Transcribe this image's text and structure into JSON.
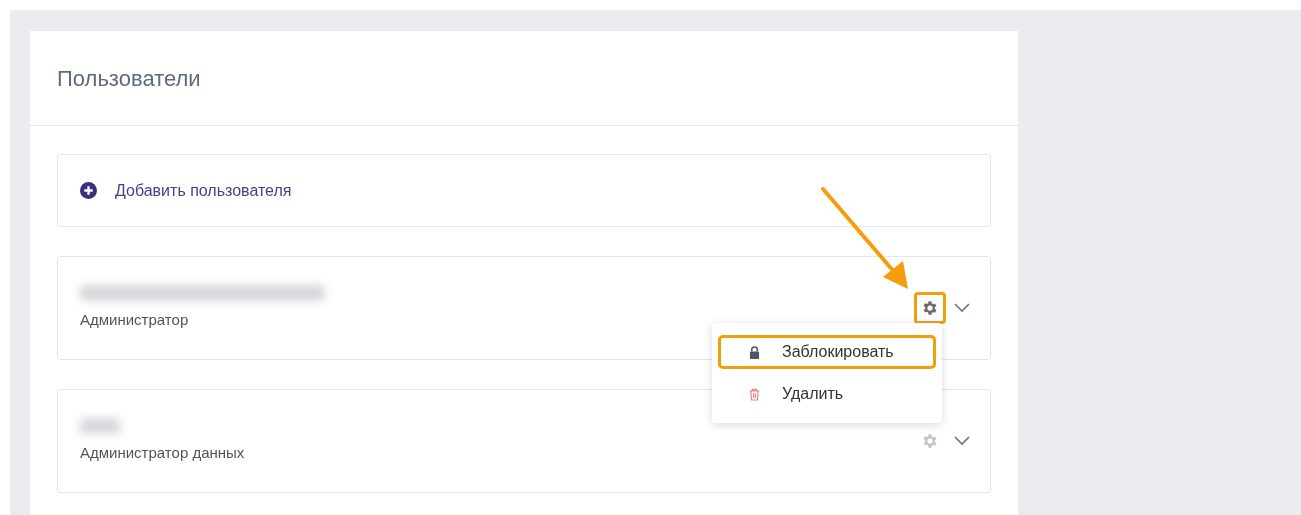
{
  "title": "Пользователи",
  "add_button": {
    "label": "Добавить пользователя"
  },
  "users": [
    {
      "role": "Администратор",
      "menu_open": true
    },
    {
      "role": "Администратор данных",
      "menu_open": false
    }
  ],
  "menu": {
    "items": [
      {
        "kind": "lock",
        "label": "Заблокировать",
        "highlighted": true
      },
      {
        "kind": "delete",
        "label": "Удалить",
        "highlighted": false
      }
    ]
  }
}
